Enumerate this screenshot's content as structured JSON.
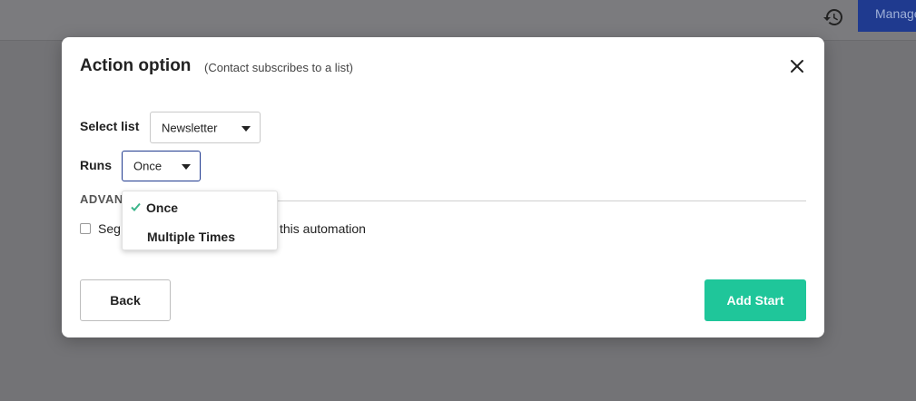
{
  "topbar": {
    "manage_label": "Manage"
  },
  "modal": {
    "title": "Action option",
    "subtitle": "(Contact subscribes to a list)",
    "select_list_label": "Select list",
    "select_list_value": "Newsletter",
    "runs_label": "Runs",
    "runs_value": "Once",
    "advanced_label": "ADVAN",
    "segment_text_a": "Segı",
    "segment_text_b": "this automation",
    "back_label": "Back",
    "add_start_label": "Add Start"
  },
  "runs_dropdown": {
    "options": [
      {
        "label": "Once",
        "selected": true
      },
      {
        "label": "Multiple Times",
        "selected": false
      }
    ]
  },
  "colors": {
    "accent_green": "#1fc69a",
    "brand_blue": "#1f3a8f",
    "check_green": "#3bb58a"
  },
  "icons": [
    "history-icon",
    "close-icon",
    "check-icon",
    "caret-down-icon"
  ]
}
